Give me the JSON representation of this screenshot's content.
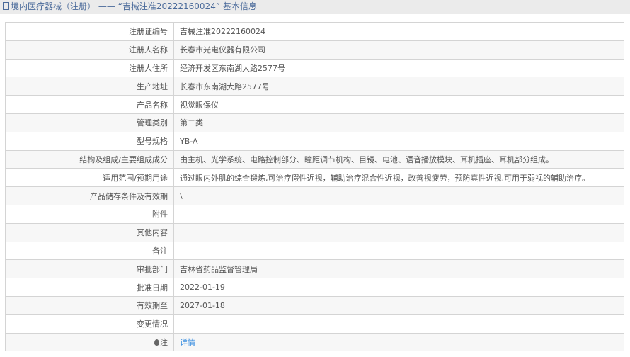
{
  "title": "境内医疗器械（注册） —— “吉械注准20222160024” 基本信息",
  "rows": [
    {
      "label": "注册证编号",
      "value": "吉械注准20222160024"
    },
    {
      "label": "注册人名称",
      "value": "长春市光电仪器有限公司"
    },
    {
      "label": "注册人住所",
      "value": "经济开发区东南湖大路2577号"
    },
    {
      "label": "生产地址",
      "value": "长春市东南湖大路2577号"
    },
    {
      "label": "产品名称",
      "value": "视觉眼保仪"
    },
    {
      "label": "管理类别",
      "value": "第二类"
    },
    {
      "label": "型号规格",
      "value": "YB-A"
    },
    {
      "label": "结构及组成/主要组成成分",
      "value": "由主机、光学系统、电路控制部分、瞳距调节机构、目镜、电池、语音播放模块、耳机插座、耳机部分组成。"
    },
    {
      "label": "适用范围/预期用途",
      "value": "通过眼内外肌的综合锻炼,可治疗假性近视，辅助治疗混合性近视，改善视疲劳，预防真性近视,可用于弱视的辅助治疗。"
    },
    {
      "label": "产品储存条件及有效期",
      "value": "\\"
    },
    {
      "label": "附件",
      "value": ""
    },
    {
      "label": "其他内容",
      "value": ""
    },
    {
      "label": "备注",
      "value": ""
    },
    {
      "label": "审批部门",
      "value": "吉林省药品监督管理局"
    },
    {
      "label": "批准日期",
      "value": "2022-01-19"
    },
    {
      "label": "有效期至",
      "value": "2027-01-18"
    },
    {
      "label": "变更情况",
      "value": ""
    }
  ],
  "note": {
    "label": "注",
    "link": "详情"
  }
}
